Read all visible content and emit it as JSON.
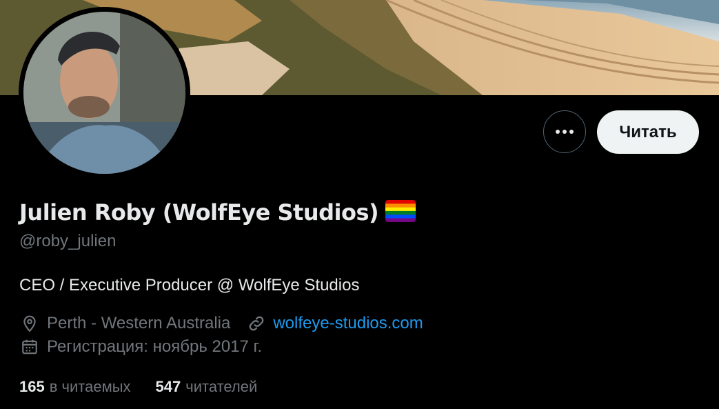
{
  "profile": {
    "display_name": "Julien Roby (WolfEye Studios)",
    "flag_icon": "rainbow-flag-icon",
    "handle": "@roby_julien",
    "bio": "CEO / Executive Producer @ WolfEye Studios",
    "location": "Perth - Western Australia",
    "website": "wolfeye-studios.com",
    "joined": "Регистрация: ноябрь 2017 г."
  },
  "actions": {
    "more_icon": "more-dots-icon",
    "follow_label": "Читать"
  },
  "stats": {
    "following_count": "165",
    "following_label": "в читаемых",
    "followers_count": "547",
    "followers_label": "читателей"
  },
  "colors": {
    "background": "#000000",
    "text_primary": "#e7e9ea",
    "text_secondary": "#71767b",
    "link": "#1d9bf0",
    "follow_button_bg": "#eff3f4"
  }
}
